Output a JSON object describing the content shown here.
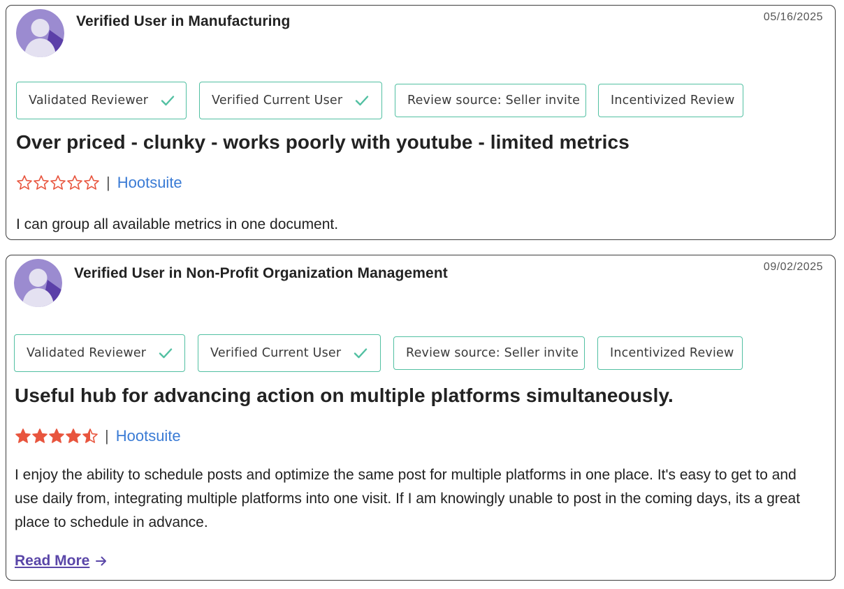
{
  "reviews": [
    {
      "reviewer": "Verified User in Manufacturing",
      "date": "05/16/2025",
      "badges": [
        {
          "label": "Validated Reviewer",
          "icon": "check-icon"
        },
        {
          "label": "Verified Current User",
          "icon": "check-icon"
        },
        {
          "label": "Review source: Seller invite"
        },
        {
          "label": "Incentivized Review"
        }
      ],
      "title": "Over priced - clunky - works poorly with youtube - limited metrics",
      "rating": 0,
      "rating_max": 5,
      "separator": "|",
      "product": "Hootsuite",
      "body": "I can group all available metrics in one document."
    },
    {
      "reviewer": "Verified User in Non-Profit Organization Management",
      "date": "09/02/2025",
      "badges": [
        {
          "label": "Validated Reviewer",
          "icon": "check-icon"
        },
        {
          "label": "Verified Current User",
          "icon": "check-icon"
        },
        {
          "label": "Review source: Seller invite"
        },
        {
          "label": "Incentivized Review"
        }
      ],
      "title": "Useful hub for advancing action on multiple platforms simultaneously.",
      "rating": 4.5,
      "rating_max": 5,
      "separator": "|",
      "product": "Hootsuite",
      "body": "I enjoy the ability to schedule posts and optimize the same post for multiple platforms in one place. It's easy to get to and use daily from, integrating multiple platforms into one visit. If I am knowingly unable to post in the coming days, its a great place to schedule in advance.",
      "read_more": "Read More"
    }
  ],
  "colors": {
    "badge_border": "#52c0a2",
    "star": "#e8553e",
    "link": "#3a7bd5",
    "read_more": "#5a46a8",
    "avatar_bg": "#9b8bd0",
    "avatar_shadow": "#5b3fa8",
    "avatar_figure": "#e4e1f1"
  }
}
